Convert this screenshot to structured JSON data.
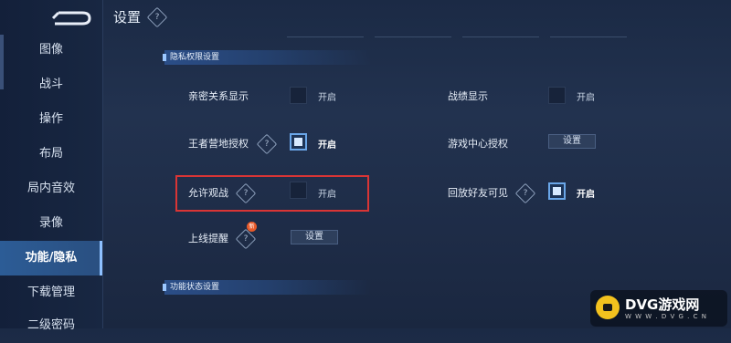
{
  "header": {
    "title": "设置",
    "help_glyph": "?"
  },
  "sidebar": {
    "items": [
      {
        "label": "图像"
      },
      {
        "label": "战斗"
      },
      {
        "label": "操作"
      },
      {
        "label": "布局"
      },
      {
        "label": "局内音效"
      },
      {
        "label": "录像"
      },
      {
        "label": "功能/隐私",
        "active": true
      },
      {
        "label": "下载管理"
      },
      {
        "label": "二级密码"
      }
    ]
  },
  "sections": {
    "privacy": {
      "title": "隐私权限设置"
    },
    "feature_status": {
      "title": "功能状态设置"
    }
  },
  "settings": {
    "intimate_display": {
      "label": "亲密关系显示",
      "checked": false,
      "state": "开启"
    },
    "stats_display": {
      "label": "战绩显示",
      "checked": false,
      "state": "开启"
    },
    "camp_auth": {
      "label": "王者营地授权",
      "checked": true,
      "state": "开启"
    },
    "game_center_auth": {
      "label": "游戏中心授权",
      "button": "设置"
    },
    "allow_spectate": {
      "label": "允许观战",
      "checked": false,
      "state": "开启"
    },
    "replay_visible": {
      "label": "回放好友可见",
      "checked": true,
      "state": "开启"
    },
    "online_reminder": {
      "label": "上线提醒",
      "button": "设置",
      "badge": "新"
    }
  },
  "watermark": {
    "title": "DVG游戏网",
    "subtitle": "W W W . D V G . C N"
  },
  "colors": {
    "accent": "#6aa6e8",
    "highlight": "#d93535",
    "active_tab": "#2c5c96"
  }
}
